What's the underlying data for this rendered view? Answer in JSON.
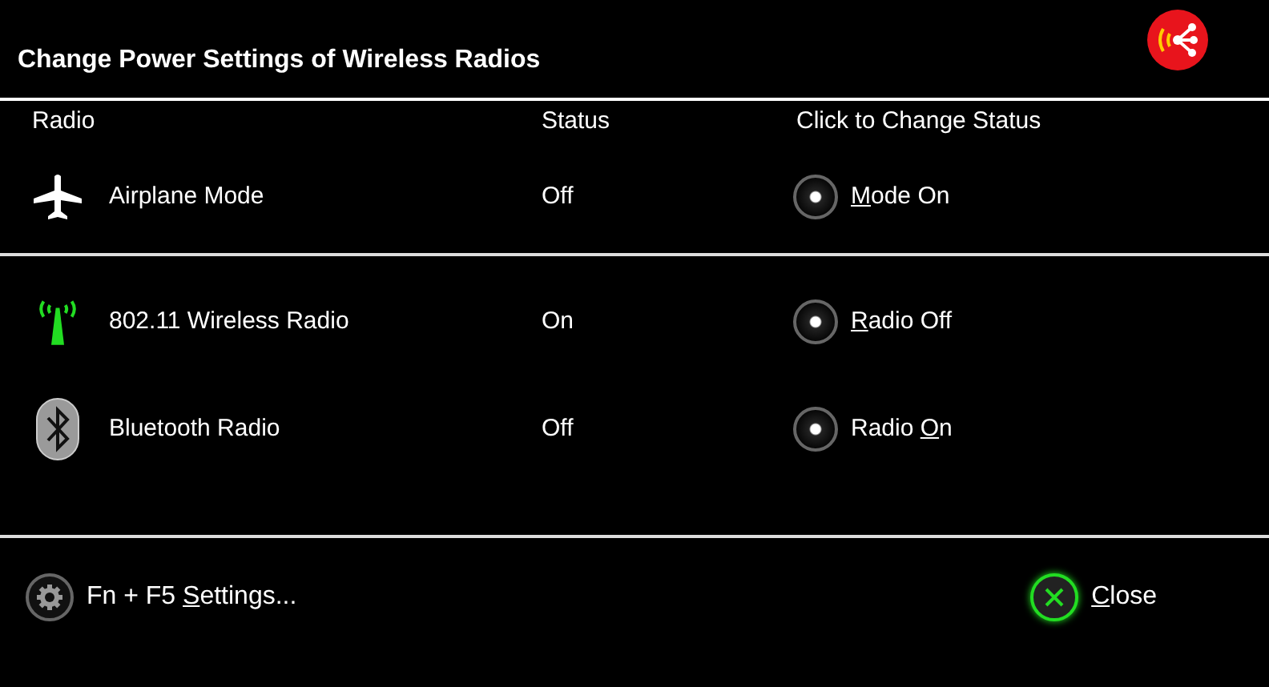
{
  "window": {
    "title": "Change Power Settings of Wireless Radios"
  },
  "columns": [
    "Radio",
    "Status",
    "Click to Change Status"
  ],
  "groups": [
    {
      "rows": [
        {
          "kind": "airplane",
          "name": "Airplane Mode",
          "status": "Off",
          "action": {
            "key": "M",
            "after": "ode On"
          }
        }
      ]
    },
    {
      "rows": [
        {
          "kind": "wifi",
          "name": "802.11 Wireless Radio",
          "status": "On",
          "action": {
            "key": "R",
            "after": "adio Off"
          }
        },
        {
          "kind": "bluetooth",
          "name": "Bluetooth Radio",
          "status": "Off",
          "action": {
            "before": "Radio ",
            "key": "O",
            "after": "n"
          }
        }
      ]
    }
  ],
  "footer": {
    "settings": {
      "before": "Fn + F5 ",
      "key": "S",
      "after": "ettings..."
    },
    "close": {
      "key": "C",
      "after": "lose"
    }
  }
}
